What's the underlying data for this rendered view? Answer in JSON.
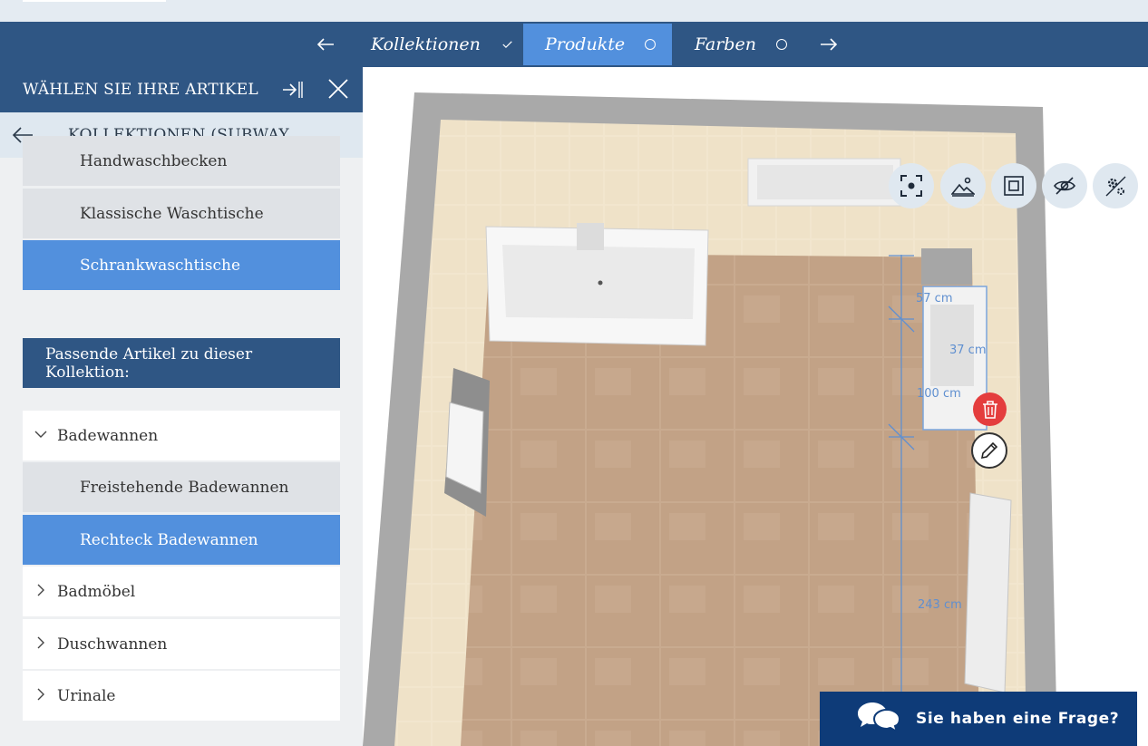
{
  "wizard": {
    "prev_icon": "arrow-left-icon",
    "next_icon": "arrow-right-icon",
    "steps": [
      {
        "label": "Kollektionen",
        "state": "done"
      },
      {
        "label": "Produkte",
        "state": "active"
      },
      {
        "label": "Farben",
        "state": "pending"
      }
    ]
  },
  "sidebar": {
    "title": "WÄHLEN SIE IHRE ARTIKEL",
    "collapse_icon": "collapse-panel-icon",
    "close_icon": "close-icon",
    "back_label": "KOLLEKTIONEN (SUBWAY ...",
    "waschtische": [
      {
        "label": "Handwaschbecken"
      },
      {
        "label": "Klassische Waschtische"
      },
      {
        "label": "Schrankwaschtische",
        "active": true
      }
    ],
    "section_title": "Passende Artikel zu dieser Kollektion:",
    "categories": [
      {
        "label": "Badewannen",
        "expanded": true
      },
      {
        "label": "Freistehende Badewannen"
      },
      {
        "label": "Rechteck Badewannen",
        "active": true
      },
      {
        "label": "Badmöbel"
      },
      {
        "label": "Duschwannen"
      },
      {
        "label": "Urinale"
      }
    ]
  },
  "viewer": {
    "tools": [
      "focus-icon",
      "landscape-icon",
      "floorplan-icon",
      "hide-icon",
      "settings-icon"
    ],
    "measurements": [
      "57 cm",
      "37 cm",
      "100 cm",
      "243 cm"
    ],
    "delete_icon": "trash-icon",
    "edit_icon": "pencil-icon"
  },
  "chat": {
    "label": "Sie haben eine Frage?",
    "icon": "chat-bubbles-icon"
  },
  "colors": {
    "primary": "#2f5684",
    "active": "#5290dd",
    "chat": "#0e3b78",
    "danger": "#e43d3d"
  }
}
